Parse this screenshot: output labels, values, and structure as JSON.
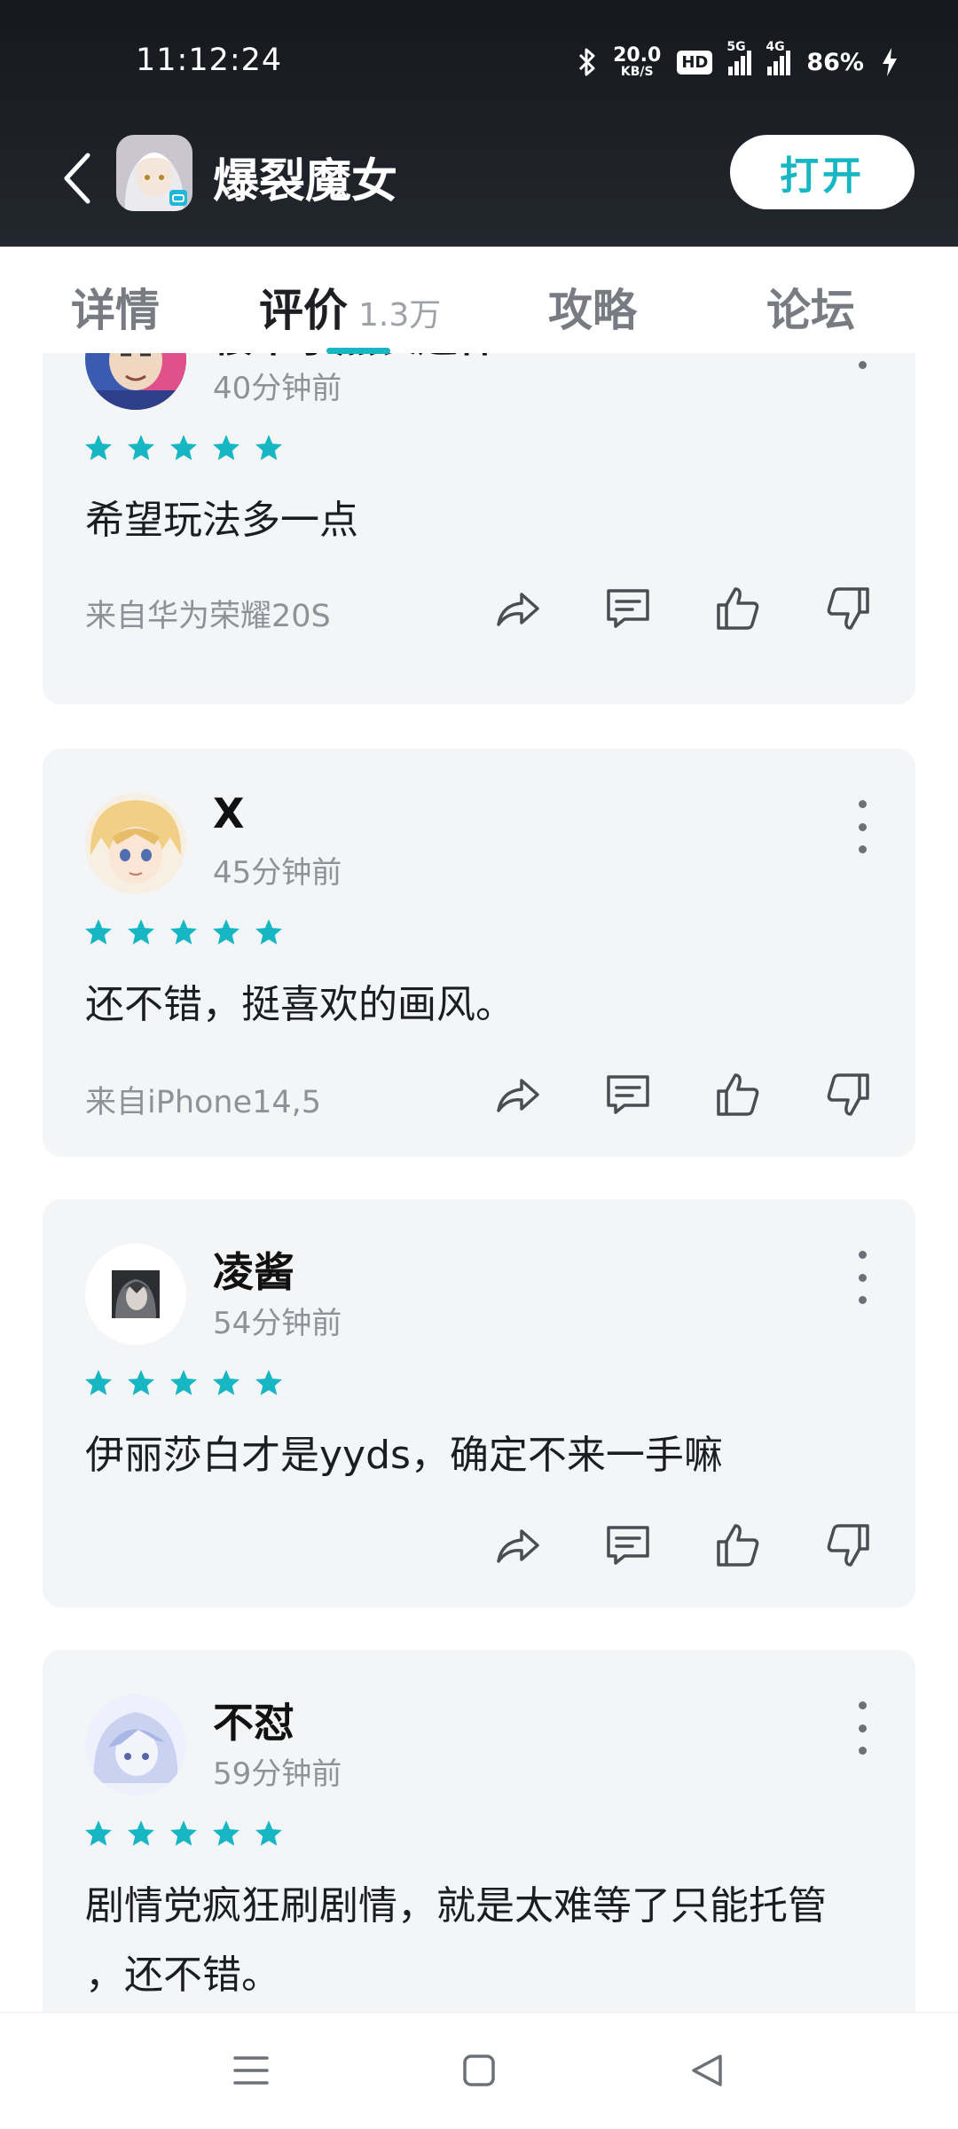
{
  "status_bar": {
    "time": "11:12:24",
    "net_speed_value": "20.0",
    "net_speed_unit": "KB/S",
    "hd_badge": "HD",
    "sim1_label": "5G",
    "sim2_label": "4G",
    "battery": "86%"
  },
  "app_bar": {
    "title": "爆裂魔女",
    "open_label": "打开"
  },
  "tabs": [
    {
      "label": "详情"
    },
    {
      "label": "评价",
      "count": "1.3万"
    },
    {
      "label": "攻略"
    },
    {
      "label": "论坛"
    }
  ],
  "colors": {
    "accent": "#16b7c3",
    "card_bg": "#f4f5f7",
    "header_bg": "#1b1e23"
  },
  "reviews": [
    {
      "user": "楼下小黑长这样",
      "time": "40分钟前",
      "rating": 5,
      "content": "希望玩法多一点",
      "source": "来自华为荣耀20S"
    },
    {
      "user": "X",
      "time": "45分钟前",
      "rating": 5,
      "content": "还不错，挺喜欢的画风。",
      "source": "来自iPhone14,5"
    },
    {
      "user": "凌酱",
      "time": "54分钟前",
      "rating": 5,
      "content": "伊丽莎白才是yyds，确定不来一手嘛",
      "source": ""
    },
    {
      "user": "不怼",
      "time": "59分钟前",
      "rating": 5,
      "content": "剧情党疯狂刷剧情，就是太难等了只能托管 ，还不错。",
      "source": ""
    }
  ],
  "icons": {
    "back": "chevron-left-icon",
    "share": "share-icon",
    "comment": "comment-icon",
    "like": "thumbs-up-icon",
    "dislike": "thumbs-down-icon",
    "more": "more-vertical-icon",
    "nav_menu": "menu-icon",
    "nav_home": "home-square-icon",
    "nav_back": "back-triangle-icon"
  }
}
